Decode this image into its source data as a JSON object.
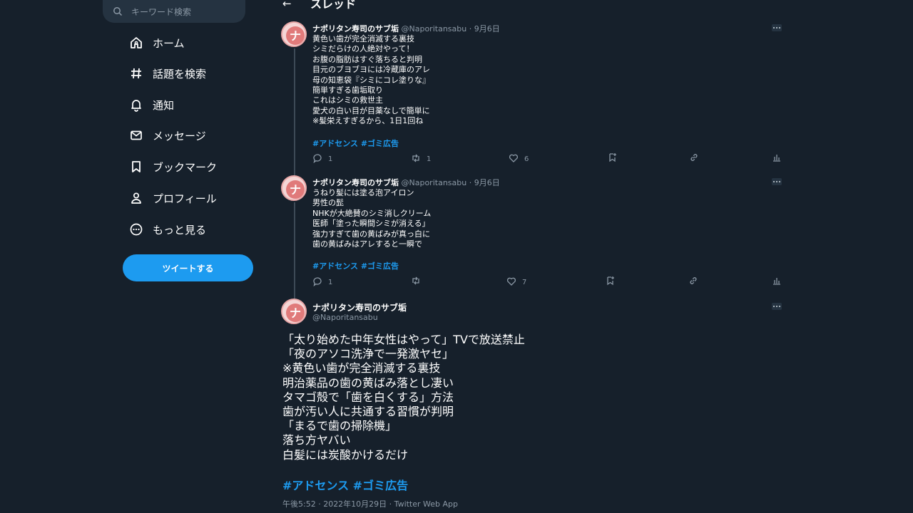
{
  "search": {
    "placeholder": "キーワード検索"
  },
  "nav": [
    {
      "label": "ホーム",
      "icon": "home-icon"
    },
    {
      "label": "話題を検索",
      "icon": "hashtag-icon"
    },
    {
      "label": "通知",
      "icon": "bell-icon"
    },
    {
      "label": "メッセージ",
      "icon": "mail-icon"
    },
    {
      "label": "ブックマーク",
      "icon": "bookmark-icon"
    },
    {
      "label": "プロフィール",
      "icon": "person-icon"
    },
    {
      "label": "もっと見る",
      "icon": "more-circle-icon"
    }
  ],
  "tweet_button": "ツイートする",
  "header": {
    "title": "スレッド"
  },
  "tweets": [
    {
      "name": "ナポリタン寿司のサブ垢",
      "handle": "@Naporitansabu",
      "dot": "·",
      "date": "9月6日",
      "lines": [
        "黄色い歯が完全消滅する裏技",
        "シミだらけの人絶対やって！",
        "お腹の脂肪はすぐ落ちると判明",
        "目元のブヨブヨには冷蔵庫のアレ",
        "母の知恵袋『シミにコレ塗りな』",
        "簡単すぎる歯垢取り",
        "これはシミの救世主",
        "愛犬の白い目が目薬なしで簡単に",
        "※髪栄えすぎるから、1日1回ね"
      ],
      "tags": "#アドセンス #ゴミ広告",
      "reply_count": "1",
      "retweet_count": "1",
      "like_count": "6"
    },
    {
      "name": "ナポリタン寿司のサブ垢",
      "handle": "@Naporitansabu",
      "dot": "·",
      "date": "9月6日",
      "lines": [
        "うねり髪には塗る泡アイロン",
        "男性の髭",
        "NHKが大絶賛のシミ消しクリーム",
        "医師「塗った瞬間シミが消える」",
        "強力すぎて歯の黄ばみが真っ白に",
        "歯の黄ばみはアレすると一瞬で"
      ],
      "tags": "#アドセンス #ゴミ広告",
      "reply_count": "1",
      "retweet_count": "",
      "like_count": "7"
    }
  ],
  "main_tweet": {
    "name": "ナポリタン寿司のサブ垢",
    "handle": "@Naporitansabu",
    "lines": [
      "「太り始めた中年女性はやって」TVで放送禁止",
      "「夜のアソコ洗浄で一発激ヤセ」",
      "※黄色い歯が完全消滅する裏技",
      "明治薬品の歯の黄ばみ落とし凄い",
      "タマゴ殻で「歯を白くする」方法",
      "歯が汚い人に共通する習慣が判明",
      "「まるで歯の掃除機」",
      "落ち方ヤバい",
      "白髪には炭酸かけるだけ"
    ],
    "tags": "#アドセンス #ゴミ広告",
    "meta": "午後5:52 · 2022年10月29日 · Twitter Web App"
  },
  "colors": {
    "background": "#16202b",
    "accent": "#1d9bf0",
    "muted": "#8b98a5"
  }
}
